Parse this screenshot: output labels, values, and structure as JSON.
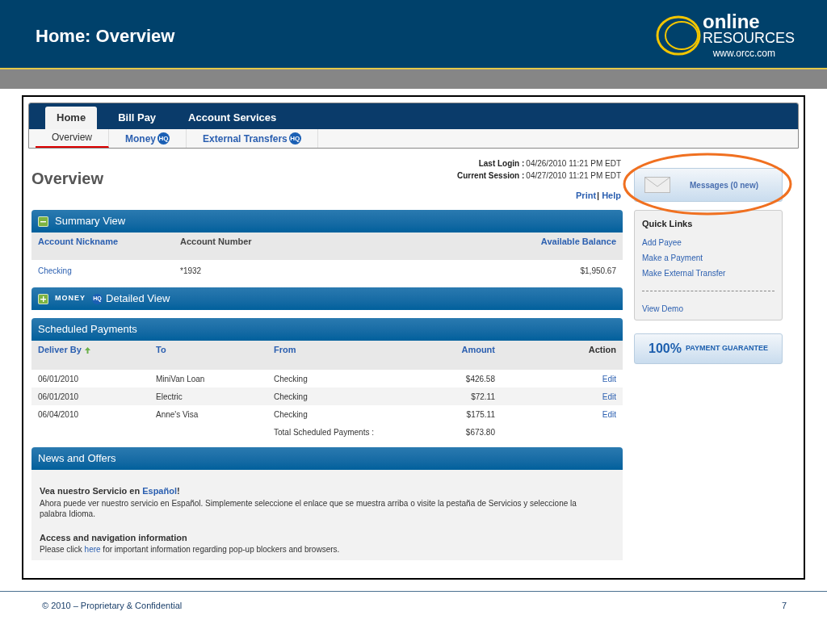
{
  "slide": {
    "title": "Home: Overview",
    "logo": {
      "word": "online",
      "sub": "RESOURCES",
      "url": "www.orcc.com"
    },
    "footer": "© 2010 – Proprietary & Confidential",
    "page": "7"
  },
  "tabs": [
    {
      "label": "Home",
      "selected": true
    },
    {
      "label": "Bill Pay",
      "selected": false
    },
    {
      "label": "Account Services",
      "selected": false
    }
  ],
  "subtabs": [
    {
      "label": "Overview",
      "selected": true
    },
    {
      "label": "Money",
      "badge": "HQ",
      "selected": false
    },
    {
      "label": "External Transfers",
      "badge": "HQ",
      "selected": false
    }
  ],
  "page_title": "Overview",
  "session": [
    {
      "label": "Last Login :",
      "value": "04/26/2010 11:21 PM EDT"
    },
    {
      "label": "Current Session :",
      "value": "04/27/2010 11:21 PM EDT"
    }
  ],
  "links": [
    "Print",
    "|",
    "Help"
  ],
  "summary": {
    "title": "Summary View",
    "expanded": true,
    "columns": [
      "Account Nickname",
      "Account Number",
      "Available Balance"
    ],
    "rows": [
      {
        "nickname": "Checking",
        "number": "*1932",
        "balance": "$1,950.67"
      }
    ]
  },
  "detailed": {
    "brand": "MONEY",
    "badge": "HQ",
    "title": "Detailed View",
    "expanded": false
  },
  "scheduled": {
    "title": "Scheduled Payments",
    "columns": [
      "Deliver By",
      "To",
      "From",
      "Amount",
      "Action"
    ],
    "rows": [
      {
        "date": "06/01/2010",
        "to": "MiniVan Loan",
        "from": "Checking",
        "amount": "$426.58",
        "action": "Edit"
      },
      {
        "date": "06/01/2010",
        "to": "Electric",
        "from": "Checking",
        "amount": "$72.11",
        "action": "Edit"
      },
      {
        "date": "06/04/2010",
        "to": "Anne's Visa",
        "from": "Checking",
        "amount": "$175.11",
        "action": "Edit"
      }
    ],
    "total_label": "Total Scheduled Payments :",
    "total": "$673.80"
  },
  "news": {
    "title": "News and Offers",
    "items": [
      {
        "heading": "Vea nuestro Servicio en ",
        "link": "Español",
        "after": "!",
        "body": "Ahora puede ver nuestro servicio en Español. Simplemente seleccione el enlace que se muestra arriba o visite la pestaña de Servicios y seleccione la palabra Idioma."
      },
      {
        "heading": "Access and navigation information",
        "body_before": "Please click ",
        "link": "here",
        "body_after": " for important information regarding pop-up blockers and browsers."
      }
    ]
  },
  "messages": "Messages (0 new)",
  "quick_links": {
    "title": "Quick Links",
    "items": [
      "Add Payee",
      "Make a Payment",
      "Make External Transfer"
    ],
    "extra": "View Demo"
  },
  "guarantee": {
    "percent": "100%",
    "text": "PAYMENT GUARANTEE"
  }
}
